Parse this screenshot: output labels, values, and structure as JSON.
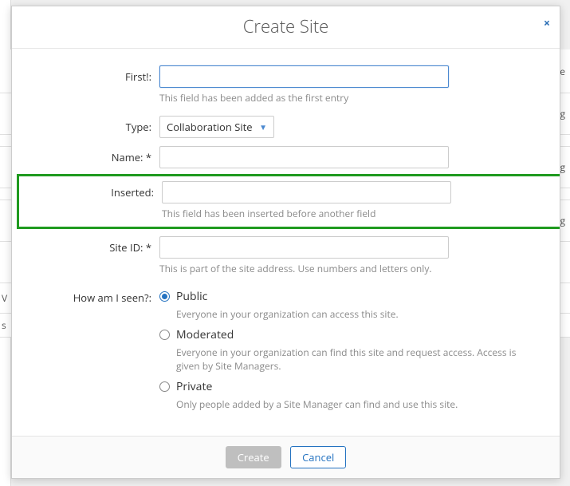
{
  "dialog": {
    "title": "Create Site",
    "close_char": "×"
  },
  "fields": {
    "first": {
      "label": "First!:",
      "value": "",
      "helper": "This field has been added as the first entry"
    },
    "type": {
      "label": "Type:",
      "value": "Collaboration Site"
    },
    "name": {
      "label": "Name: *",
      "value": ""
    },
    "inserted": {
      "label": "Inserted:",
      "value": "",
      "helper": "This field has been inserted before another field"
    },
    "siteid": {
      "label": "Site ID: *",
      "value": "",
      "helper": "This is part of the site address. Use numbers and letters only."
    },
    "visibility": {
      "label": "How am I seen?:",
      "options": [
        {
          "label": "Public",
          "desc": "Everyone in your organization can access this site.",
          "selected": true
        },
        {
          "label": "Moderated",
          "desc": "Everyone in your organization can find this site and request access. Access is given by Site Managers.",
          "selected": false
        },
        {
          "label": "Private",
          "desc": "Only people added by a Site Manager can find and use this site.",
          "selected": false
        }
      ]
    }
  },
  "footer": {
    "create": "Create",
    "cancel": "Cancel"
  },
  "bg": {
    "frag": "sig",
    "e": "e",
    "s": "s",
    "v": "V"
  }
}
